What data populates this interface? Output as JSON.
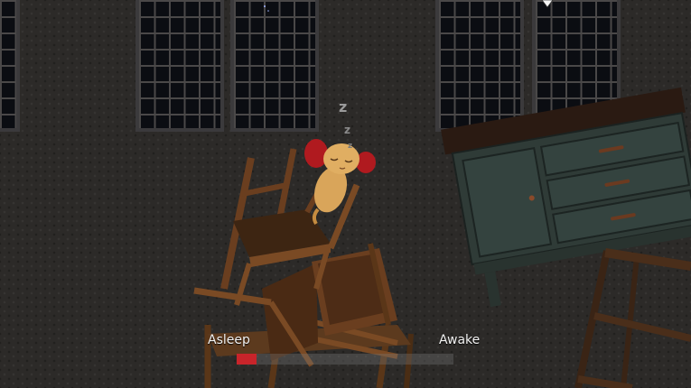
{
  "hud": {
    "left_label": "Asleep",
    "right_label": "Awake",
    "wakefulness": 0.09,
    "meter_fill_color": "#c8242a"
  },
  "sleep_indicator": "z",
  "colors": {
    "wall": "#2c2a28",
    "chair_wood": "#7a4a24",
    "dresser": "#2f3b37",
    "earmuffs": "#b01a1f",
    "cat": "#d9a55a"
  }
}
